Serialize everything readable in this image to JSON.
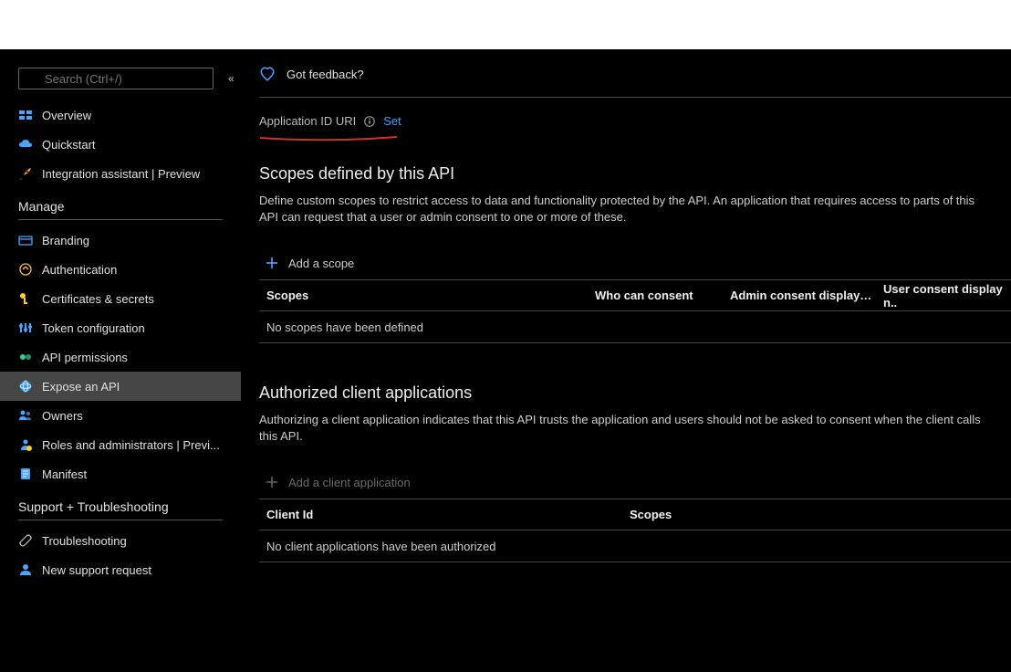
{
  "search": {
    "placeholder": "Search (Ctrl+/)"
  },
  "nav": {
    "overview": "Overview",
    "quickstart": "Quickstart",
    "integration": "Integration assistant | Preview"
  },
  "sections": {
    "manage": "Manage",
    "support": "Support + Troubleshooting"
  },
  "manage": {
    "branding": "Branding",
    "authentication": "Authentication",
    "certs": "Certificates & secrets",
    "tokenconfig": "Token configuration",
    "apiperm": "API permissions",
    "expose": "Expose an API",
    "owners": "Owners",
    "roles": "Roles and administrators | Previ...",
    "manifest": "Manifest"
  },
  "support": {
    "troubleshooting": "Troubleshooting",
    "newrequest": "New support request"
  },
  "feedback": {
    "label": "Got feedback?"
  },
  "appid": {
    "label": "Application ID URI",
    "set": "Set"
  },
  "scopes": {
    "title": "Scopes defined by this API",
    "desc": "Define custom scopes to restrict access to data and functionality protected by the API. An application that requires access to parts of this API can request that a user or admin consent to one or more of these.",
    "add": "Add a scope",
    "cols": {
      "c1": "Scopes",
      "c2": "Who can consent",
      "c3": "Admin consent display…",
      "c4": "User consent display n.."
    },
    "empty": "No scopes have been defined"
  },
  "clients": {
    "title": "Authorized client applications",
    "desc": "Authorizing a client application indicates that this API trusts the application and users should not be asked to consent when the client calls this API.",
    "add": "Add a client application",
    "cols": {
      "c1": "Client Id",
      "c2": "Scopes"
    },
    "empty": "No client applications have been authorized"
  },
  "colors": {
    "link": "#419fff"
  }
}
